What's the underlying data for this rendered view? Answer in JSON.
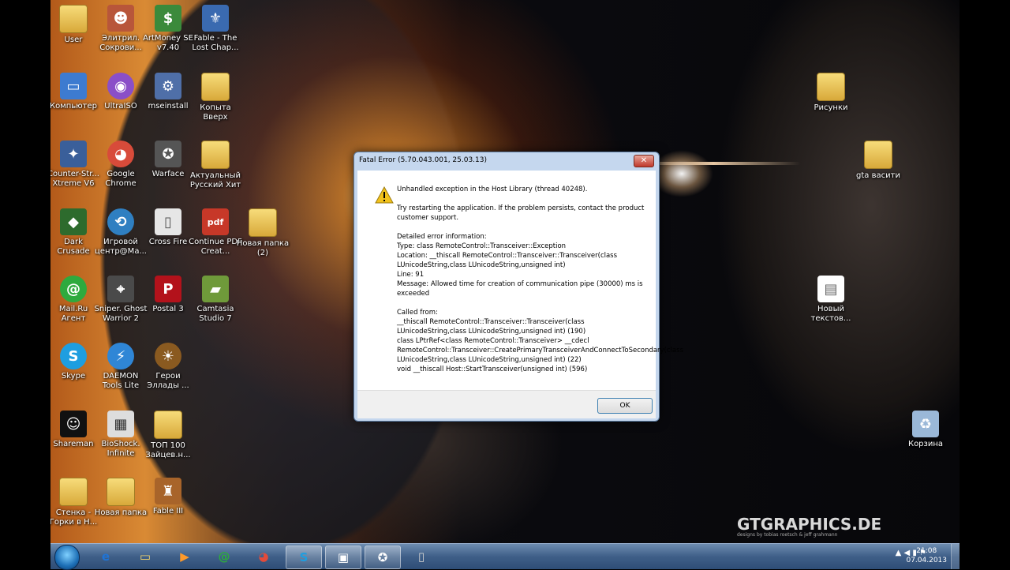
{
  "desktop_icons": [
    {
      "label": "User",
      "glyph": "",
      "color": "folder"
    },
    {
      "label": "Элитрил. Сокрови...",
      "glyph": "☻",
      "color": "#b8563a"
    },
    {
      "label": "ArtMoney SE v7.40",
      "glyph": "$",
      "color": "#3b8a3b"
    },
    {
      "label": "Fable - The Lost Chap...",
      "glyph": "⚜",
      "color": "#3a6ab0"
    },
    {
      "label": "Компьютер",
      "glyph": "▭",
      "color": "#3d7bd0"
    },
    {
      "label": "UltraISO",
      "glyph": "◉",
      "color": "#8a4fc8"
    },
    {
      "label": "mseinstall",
      "glyph": "⚙",
      "color": "#4f6fa8"
    },
    {
      "label": "Копыта Вверх",
      "glyph": "",
      "color": "folder"
    },
    {
      "label": "Counter-Str... Xtreme V6",
      "glyph": "✦",
      "color": "#3a5f9a"
    },
    {
      "label": "Google Chrome",
      "glyph": "◕",
      "color": "#d84b3a"
    },
    {
      "label": "Warface",
      "glyph": "✪",
      "color": "#555555"
    },
    {
      "label": "Актуальный Русский Хит",
      "glyph": "",
      "color": "folder"
    },
    {
      "label": "Dark Crusade",
      "glyph": "◆",
      "color": "#2d6b2d"
    },
    {
      "label": "Игровой центр@Ma...",
      "glyph": "⟲",
      "color": "#2f7fc1"
    },
    {
      "label": "Cross Fire",
      "glyph": "▯",
      "color": "#e6e6e6"
    },
    {
      "label": "Continue PDF Creat...",
      "glyph": "pdf",
      "color": "#c73828"
    },
    {
      "label": "Новая папка (2)",
      "glyph": "",
      "color": "folder"
    },
    {
      "label": "Mail.Ru Агент",
      "glyph": "@",
      "color": "#2eaa3e"
    },
    {
      "label": "Sniper. Ghost Warrior 2",
      "glyph": "⌖",
      "color": "#4a4a4a"
    },
    {
      "label": "Postal 3",
      "glyph": "P",
      "color": "#b3121b"
    },
    {
      "label": "Camtasia Studio 7",
      "glyph": "▰",
      "color": "#6f9a3a"
    },
    {
      "label": "Skype",
      "glyph": "S",
      "color": "#1e9ee0"
    },
    {
      "label": "DAEMON Tools Lite",
      "glyph": "⚡",
      "color": "#2f86d6"
    },
    {
      "label": "Герои Эллады ...",
      "glyph": "☀",
      "color": "#8a5a20"
    },
    {
      "label": "Shareman",
      "glyph": "☺",
      "color": "#111111"
    },
    {
      "label": "BioShock. Infinite",
      "glyph": "▦",
      "color": "#dddddd"
    },
    {
      "label": "ТОП 100 Зайцев.н...",
      "glyph": "",
      "color": "folder"
    },
    {
      "label": "Стенка - Горки в Н...",
      "glyph": "",
      "color": "folder"
    },
    {
      "label": "Новая папка",
      "glyph": "",
      "color": "folder"
    },
    {
      "label": "Fable III",
      "glyph": "♜",
      "color": "#a8642a"
    },
    {
      "label": "Рисунки",
      "glyph": "",
      "color": "folder"
    },
    {
      "label": "gta васити",
      "glyph": "",
      "color": "folder"
    },
    {
      "label": "Новый текстов...",
      "glyph": "▤",
      "color": "#ffffff"
    },
    {
      "label": "Корзина",
      "glyph": "♻",
      "color": "#9ab8d8"
    }
  ],
  "dialog": {
    "title": "Fatal Error (5.70.043.001, 25.03.13)",
    "close_label": "✕",
    "paragraphs": [
      "Unhandled exception in the Host Library (thread 40248).",
      "Try restarting the application. If the problem persists, contact the product customer support.",
      "Detailed error information:\nType: class RemoteControl::Transceiver::Exception\nLocation: __thiscall RemoteControl::Transceiver::Transceiver(class LUnicodeString,class LUnicodeString,unsigned int)\nLine: 91\nMessage: Allowed time for creation of communication pipe (30000) ms is exceeded",
      "Called from:\n__thiscall RemoteControl::Transceiver::Transceiver(class LUnicodeString,class LUnicodeString,unsigned int) (190)\nclass LPtrRef<class RemoteControl::Transceiver> __cdecl RemoteControl::Transceiver::CreatePrimaryTransceiverAndConnectToSecondary(class LUnicodeString,class LUnicodeString,unsigned int) (22)\nvoid __thiscall Host::StartTransceiver(unsigned int) (596)"
    ],
    "ok_label": "OK"
  },
  "watermark": {
    "brand": "GTGRAPHICS.DE",
    "tagline": "designs by tobias roetsch & jeff grahmann"
  },
  "taskbar": {
    "items": [
      {
        "icon": "ie-icon",
        "glyph": "e"
      },
      {
        "icon": "explorer-icon",
        "glyph": "▭"
      },
      {
        "icon": "media-player-icon",
        "glyph": "▶"
      },
      {
        "icon": "mail-agent-icon",
        "glyph": "@"
      },
      {
        "icon": "chrome-icon",
        "glyph": "◕"
      },
      {
        "icon": "skype-icon",
        "glyph": "S"
      },
      {
        "icon": "camera-icon",
        "glyph": "▣"
      },
      {
        "icon": "warface-icon",
        "glyph": "✪"
      },
      {
        "icon": "blank-window-icon",
        "glyph": "▯"
      }
    ],
    "tray_icons": "▲ ◀ ▮ ⚑",
    "time": "21:08",
    "date": "07.04.2013"
  }
}
